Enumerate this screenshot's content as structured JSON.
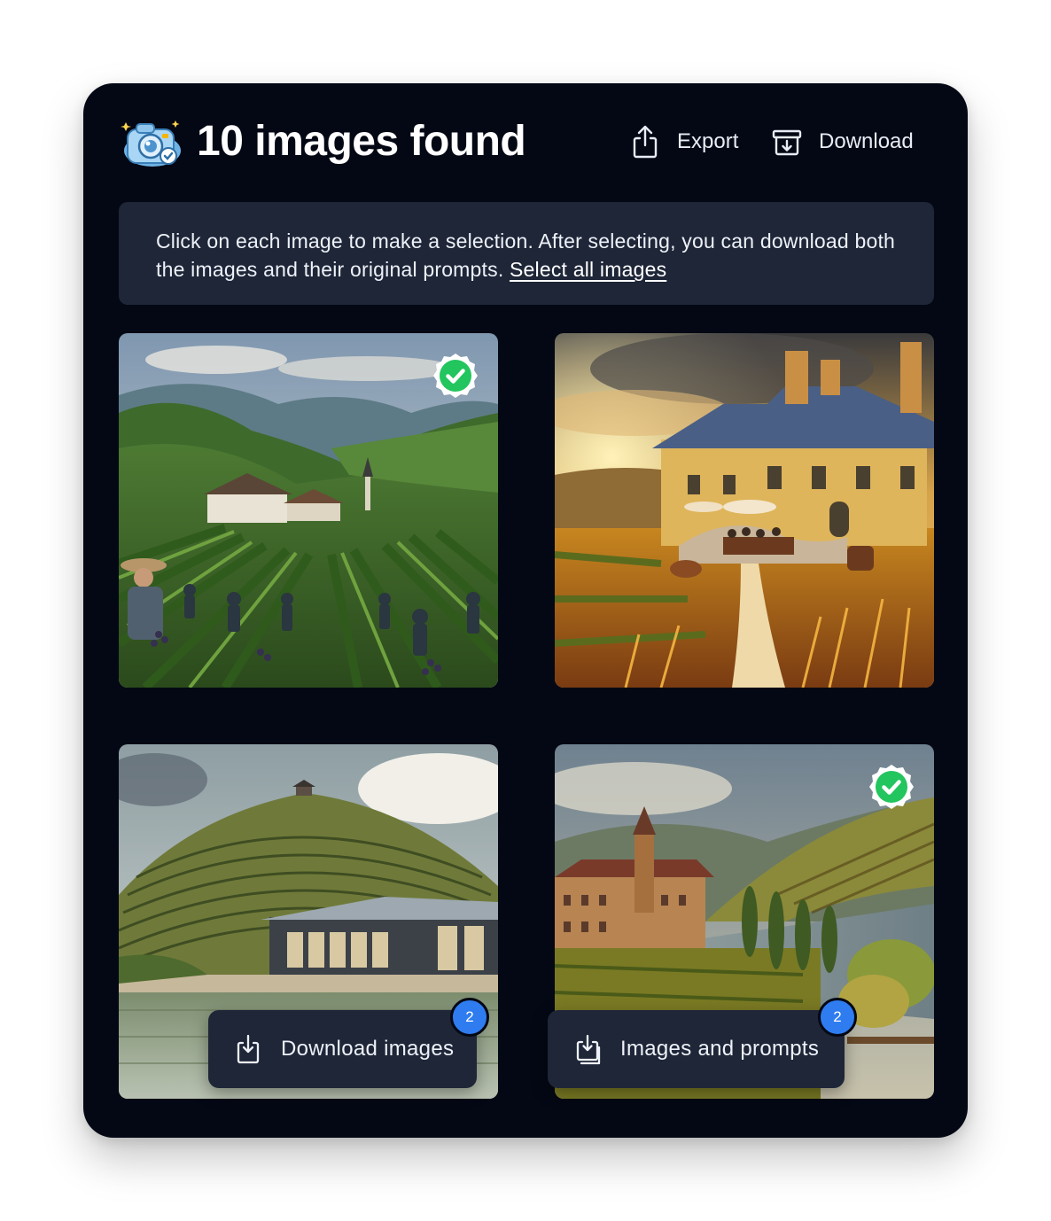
{
  "header": {
    "title": "10 images found",
    "export_label": "Export",
    "download_label": "Download"
  },
  "info": {
    "text": "Click on each image to make a selection. After selecting, you can download both the images and their original prompts.",
    "select_all_label": "Select all images"
  },
  "images": [
    {
      "id": "vineyard-harvest",
      "selected": true
    },
    {
      "id": "sunset-chateau",
      "selected": false
    },
    {
      "id": "hill-winery",
      "selected": false
    },
    {
      "id": "river-abbey",
      "selected": true
    }
  ],
  "actions": {
    "download_images_label": "Download images",
    "download_images_count": "2",
    "images_prompts_label": "Images and prompts",
    "images_prompts_count": "2"
  },
  "colors": {
    "panel_bg": "#040814",
    "card_bg": "#1e2638",
    "check_green": "#22c55e",
    "badge_blue": "#2f7cf0"
  }
}
